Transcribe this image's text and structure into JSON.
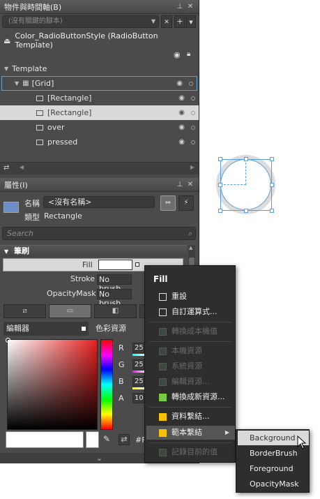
{
  "objects_panel": {
    "title": "物件與時間軸(B)",
    "scope_placeholder": "(沒有關鍵的腳本)",
    "template_title": "Color_RadioButtonStyle (RadioButton Template)",
    "tree": [
      {
        "label": "Template"
      },
      {
        "label": "[Grid]"
      },
      {
        "label": "[Rectangle]"
      },
      {
        "label": "[Rectangle]"
      },
      {
        "label": "over"
      },
      {
        "label": "pressed"
      }
    ]
  },
  "properties_panel": {
    "title": "屬性(I)",
    "name_label": "名稱",
    "name_value": "<沒有名稱>",
    "type_label": "類型",
    "type_value": "Rectangle",
    "search_placeholder": "Search",
    "category": "筆刷",
    "fill_label": "Fill",
    "stroke_label": "Stroke",
    "stroke_value": "No brush",
    "opacitymask_label": "OpacityMask",
    "opacitymask_value": "No brush",
    "editor_tab": "編輯器",
    "color_resources_tab": "色彩資源",
    "channels": [
      {
        "label": "R",
        "value": "25"
      },
      {
        "label": "G",
        "value": "25"
      },
      {
        "label": "B",
        "value": "25"
      },
      {
        "label": "A",
        "value": "10"
      }
    ],
    "hex_prefix": "#F"
  },
  "context_menu": {
    "title": "Fill",
    "items": [
      {
        "label": "重設"
      },
      {
        "label": "自訂運算式..."
      },
      {
        "label": "轉換成本機值"
      },
      {
        "label": "本機資源"
      },
      {
        "label": "系統資源"
      },
      {
        "label": "編輯資源..."
      },
      {
        "label": "轉換成新資源..."
      },
      {
        "label": "資料繫結..."
      },
      {
        "label": "範本繫結"
      },
      {
        "label": "記錄目前的值"
      }
    ]
  },
  "submenu": {
    "items": [
      {
        "label": "Background"
      },
      {
        "label": "BorderBrush"
      },
      {
        "label": "Foreground"
      },
      {
        "label": "OpacityMask"
      }
    ]
  },
  "colors": {
    "selection_blue": "#5aa0dc",
    "panel_bg": "#4b4b4b",
    "menu_bg": "#2e2e2e",
    "new_resource_green": "#7ac943",
    "binding_yellow": "#f7c000"
  }
}
